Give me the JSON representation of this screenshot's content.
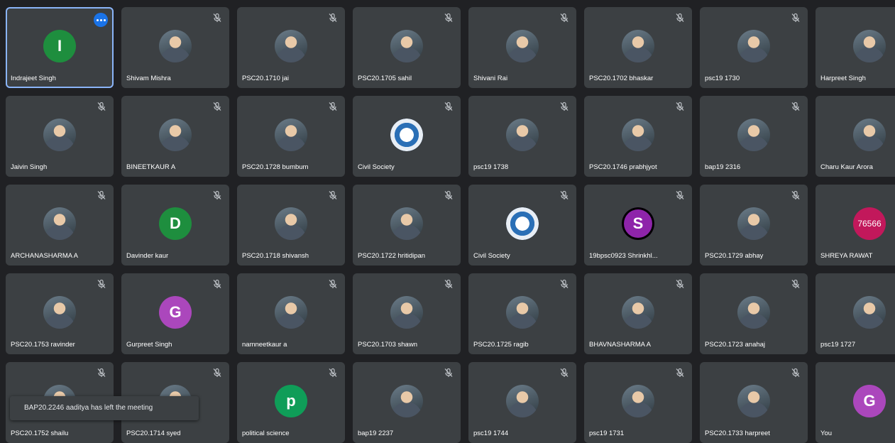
{
  "colors": {
    "tile_bg": "#3c4043",
    "page_bg": "#202124",
    "active_border": "#8ab4f8",
    "badge": "#1a73e8"
  },
  "participants": [
    {
      "name": "Indrajeet Singh",
      "avatar": "letter",
      "letter": "I",
      "color": "#1e8e3e",
      "mic": "none",
      "speaking": true
    },
    {
      "name": "Shivam Mishra",
      "avatar": "photo",
      "mic": "muted"
    },
    {
      "name": "PSC20.1710 jai",
      "avatar": "photo",
      "mic": "muted"
    },
    {
      "name": "PSC20.1705 sahil",
      "avatar": "photo",
      "mic": "muted"
    },
    {
      "name": "Shivani Rai",
      "avatar": "photo",
      "mic": "muted"
    },
    {
      "name": "PSC20.1702 bhaskar",
      "avatar": "photo",
      "mic": "muted"
    },
    {
      "name": "psc19 1730",
      "avatar": "photo",
      "mic": "muted"
    },
    {
      "name": "Harpreet Singh",
      "avatar": "photo",
      "mic": "none"
    },
    {
      "name": "Jaivin Singh",
      "avatar": "photo",
      "mic": "muted"
    },
    {
      "name": "BINEETKAUR A",
      "avatar": "photo",
      "mic": "muted"
    },
    {
      "name": "PSC20.1728 bumbum",
      "avatar": "photo",
      "mic": "muted"
    },
    {
      "name": "Civil Society",
      "avatar": "logo",
      "mic": "muted"
    },
    {
      "name": "psc19 1738",
      "avatar": "photo",
      "mic": "muted"
    },
    {
      "name": "PSC20.1746 prabhjyot",
      "avatar": "photo",
      "mic": "muted"
    },
    {
      "name": "bap19 2316",
      "avatar": "photo",
      "mic": "muted"
    },
    {
      "name": "Charu Kaur Arora",
      "avatar": "photo",
      "mic": "none"
    },
    {
      "name": "ARCHANASHARMA A",
      "avatar": "photo",
      "mic": "muted"
    },
    {
      "name": "Davinder kaur",
      "avatar": "letter",
      "letter": "D",
      "color": "#1e8e3e",
      "mic": "muted"
    },
    {
      "name": "PSC20.1718 shivansh",
      "avatar": "photo",
      "mic": "muted"
    },
    {
      "name": "PSC20.1722 hritidipan",
      "avatar": "photo",
      "mic": "muted"
    },
    {
      "name": "Civil Society",
      "avatar": "logo",
      "mic": "muted"
    },
    {
      "name": "19bpsc0923 Shrinkhl...",
      "avatar": "letter",
      "letter": "S",
      "color": "#8e24aa",
      "ring": true,
      "mic": "muted"
    },
    {
      "name": "PSC20.1729 abhay",
      "avatar": "photo",
      "mic": "muted"
    },
    {
      "name": "SHREYA RAWAT",
      "avatar": "letter",
      "letter": "76566",
      "color": "#c2185b",
      "mic": "none"
    },
    {
      "name": "PSC20.1753 ravinder",
      "avatar": "photo",
      "mic": "muted"
    },
    {
      "name": "Gurpreet Singh",
      "avatar": "letter",
      "letter": "G",
      "color": "#ab47bc",
      "mic": "muted"
    },
    {
      "name": "namneetkaur a",
      "avatar": "photo",
      "mic": "muted"
    },
    {
      "name": "PSC20.1703 shawn",
      "avatar": "photo",
      "mic": "muted"
    },
    {
      "name": "PSC20.1725 ragib",
      "avatar": "photo",
      "mic": "muted"
    },
    {
      "name": "BHAVNASHARMA A",
      "avatar": "photo",
      "mic": "muted"
    },
    {
      "name": "PSC20.1723 anahaj",
      "avatar": "photo",
      "mic": "muted"
    },
    {
      "name": "psc19 1727",
      "avatar": "photo",
      "mic": "none"
    },
    {
      "name": "PSC20.1752 shailu",
      "avatar": "photo",
      "mic": "muted"
    },
    {
      "name": "PSC20.1714 syed",
      "avatar": "photo",
      "mic": "muted"
    },
    {
      "name": "political science",
      "avatar": "letter",
      "letter": "p",
      "color": "#0f9d58",
      "mic": "muted"
    },
    {
      "name": "bap19 2237",
      "avatar": "photo",
      "mic": "muted"
    },
    {
      "name": "psc19 1744",
      "avatar": "photo",
      "mic": "muted"
    },
    {
      "name": "psc19 1731",
      "avatar": "photo",
      "mic": "muted"
    },
    {
      "name": "PSC20.1733 harpreet",
      "avatar": "photo",
      "mic": "muted"
    },
    {
      "name": "You",
      "avatar": "letter",
      "letter": "G",
      "color": "#ab47bc",
      "mic": "none"
    }
  ],
  "toast": {
    "text": "BAP20.2246 aaditya has left the meeting"
  }
}
